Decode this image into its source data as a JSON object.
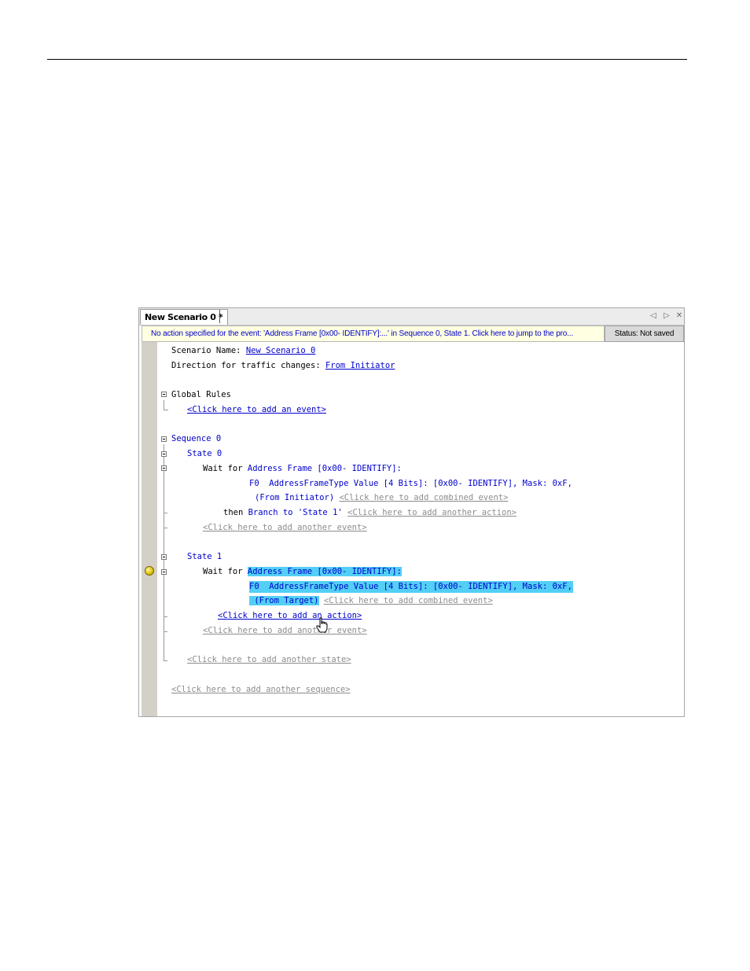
{
  "window": {
    "tab_title": "New Scenario 0 *",
    "controls": {
      "prev": "◁",
      "next": "▷",
      "close": "✕"
    },
    "warning": "No action specified for the event: 'Address Frame [0x00- IDENTIFY]:...' in Sequence 0, State 1.  Click here to jump to the pro...",
    "status": "Status: Not saved"
  },
  "scenario": {
    "name_label": "Scenario Name: ",
    "name_value": "New Scenario 0",
    "direction_label": "Direction for traffic changes: ",
    "direction_value": "From Initiator"
  },
  "global_rules": {
    "label": "Global Rules",
    "add_event": "<Click here to add an event>"
  },
  "sequence0": {
    "label": "Sequence 0",
    "state0": {
      "label": "State 0",
      "wait_for": "Wait for ",
      "event": "Address Frame [0x00- IDENTIFY]:",
      "field": "F0  AddressFrameType Value [4 Bits]: [0x00- IDENTIFY], Mask: 0xF,",
      "from": "(From Initiator)",
      "add_combined": "<Click here to add combined event>",
      "then": "then ",
      "branch": "Branch to 'State 1'",
      "add_action": "<Click here to add another action>",
      "add_event": "<Click here to add another event>"
    },
    "state1": {
      "label": "State 1",
      "wait_for": "Wait for ",
      "event": "Address Frame [0x00- IDENTIFY]:",
      "field": "F0  AddressFrameType Value [4 Bits]: [0x00- IDENTIFY], Mask: 0xF,",
      "from": " (From Target)",
      "add_combined": "<Click here to add combined event>",
      "add_an_action": "<Click here to add an action>",
      "add_event": "<Click here to add another event>"
    },
    "add_state": "<Click here to add another state>"
  },
  "add_sequence": "<Click here to add another sequence>",
  "icons": {
    "breakpoint": "breakpoint-icon",
    "cursor": "hand-cursor-icon",
    "expander": "minus-box-icon"
  }
}
